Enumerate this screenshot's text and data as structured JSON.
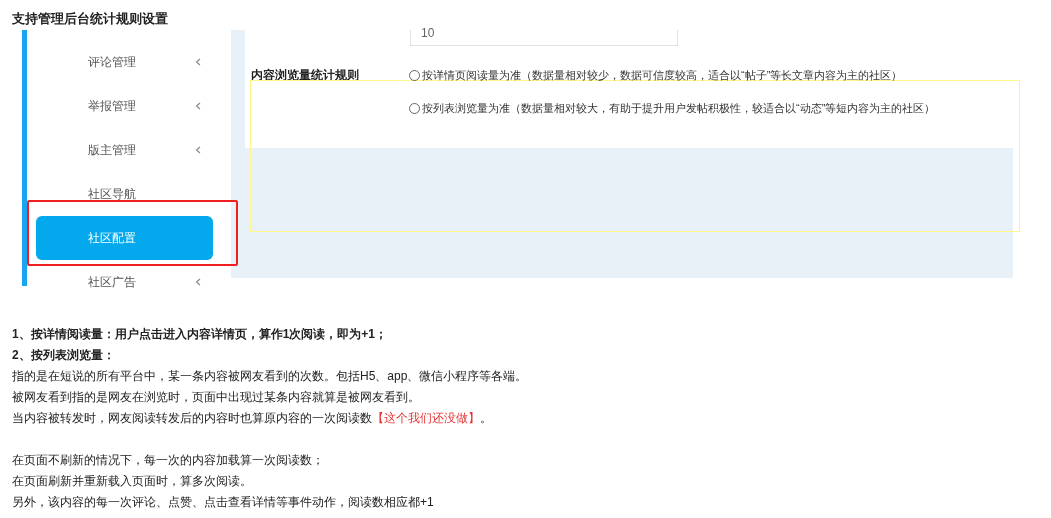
{
  "title": "支持管理后台统计规则设置",
  "sidebar": {
    "items": [
      {
        "label": "评论管理",
        "has_submenu": true,
        "selected": false
      },
      {
        "label": "举报管理",
        "has_submenu": true,
        "selected": false
      },
      {
        "label": "版主管理",
        "has_submenu": true,
        "selected": false
      },
      {
        "label": "社区导航",
        "has_submenu": false,
        "selected": false
      },
      {
        "label": "社区配置",
        "has_submenu": false,
        "selected": true
      },
      {
        "label": "社区广告",
        "has_submenu": true,
        "selected": false
      }
    ]
  },
  "settings": {
    "threshold_value": "10",
    "rule_label": "内容浏览量统计规则",
    "options": [
      {
        "label": "按详情页阅读量为准（数据量相对较少，数据可信度较高，适合以“帖子”等长文章内容为主的社区）",
        "selected": false
      },
      {
        "label": "按列表浏览量为准（数据量相对较大，有助于提升用户发帖积极性，较适合以“动态”等短内容为主的社区）",
        "selected": false
      }
    ]
  },
  "notes": [
    [
      {
        "kind": "bold",
        "parts": [
          {
            "text": "1、按详情阅读量：用户点击进入内容详情页，算作1次阅读，即为+1；",
            "red": false
          }
        ]
      },
      {
        "kind": "bold",
        "parts": [
          {
            "text": "2、按列表浏览量：",
            "red": false
          }
        ]
      },
      {
        "kind": "normal",
        "parts": [
          {
            "text": "指的是在短说的所有平台中，某一条内容被网友看到的次数。包括H5、app、微信小程序等各端。",
            "red": false
          }
        ]
      },
      {
        "kind": "normal",
        "parts": [
          {
            "text": "被网友看到指的是网友在浏览时，页面中出现过某条内容就算是被网友看到。",
            "red": false
          }
        ]
      },
      {
        "kind": "normal",
        "parts": [
          {
            "text": "当内容被转发时，网友阅读转发后的内容时也算原内容的一次阅读数",
            "red": false
          },
          {
            "text": "【这个我们还没做】",
            "red": true
          },
          {
            "text": "。",
            "red": false
          }
        ]
      }
    ],
    [
      {
        "kind": "normal",
        "parts": [
          {
            "text": "在页面不刷新的情况下，每一次的内容加载算一次阅读数；",
            "red": false
          }
        ]
      },
      {
        "kind": "normal",
        "parts": [
          {
            "text": "在页面刷新并重新载入页面时，算多次阅读。",
            "red": false
          }
        ]
      },
      {
        "kind": "normal",
        "parts": [
          {
            "text": "另外，该内容的每一次评论、点赞、点击查看详情等事件动作，阅读数相应都+1",
            "red": false
          }
        ]
      }
    ]
  ]
}
